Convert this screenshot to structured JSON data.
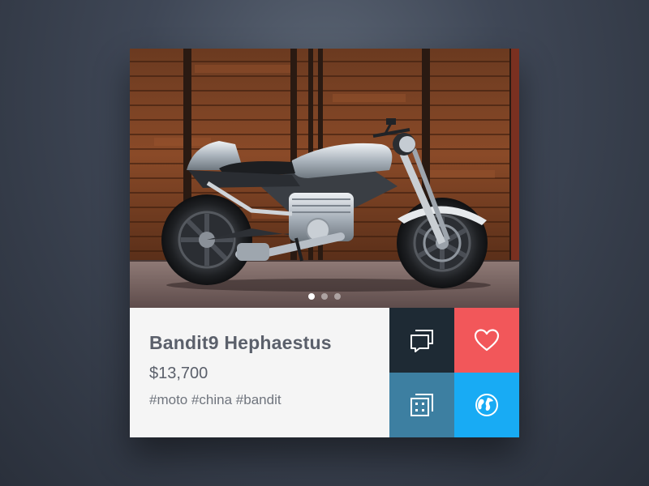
{
  "product": {
    "title": "Bandit9 Hephaestus",
    "price": "$13,700",
    "tags": "#moto #china #bandit"
  },
  "carousel": {
    "image": "motorcycle-photo",
    "slide_count": 3,
    "active_slide": 1
  },
  "actions": [
    {
      "name": "comments",
      "icon": "comments-icon",
      "color": "#1e2a34"
    },
    {
      "name": "like",
      "icon": "heart-icon",
      "color": "#f2575a"
    },
    {
      "name": "gallery",
      "icon": "gallery-icon",
      "color": "#3d7fa1"
    },
    {
      "name": "globe",
      "icon": "globe-icon",
      "color": "#18abf4"
    }
  ]
}
